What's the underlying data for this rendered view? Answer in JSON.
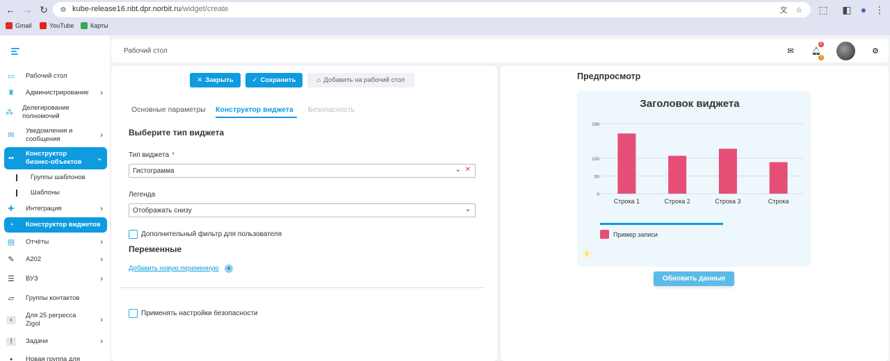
{
  "browser": {
    "url_host": "kube-release16.nbt.dpr.norbit.ru",
    "url_path": "/widget/create",
    "bookmarks": [
      {
        "label": "Gmail",
        "color": "#d93025"
      },
      {
        "label": "YouTube",
        "color": "#e62117"
      },
      {
        "label": "Карты",
        "color": "#34a853"
      }
    ]
  },
  "topbar": {
    "breadcrumb": "Рабочий стол",
    "notifications_count": "5",
    "tasks_count": "1"
  },
  "sidebar": {
    "items": [
      {
        "label": "Рабочий стол",
        "icon": "monitor-icon"
      },
      {
        "label": "Администрирование",
        "icon": "admin-icon"
      },
      {
        "label": "Делегирование полномочий",
        "icon": "delegation-icon"
      },
      {
        "label": "Уведомления и сообщения",
        "icon": "mail-icon"
      },
      {
        "label": "Конструктор бизнес-объектов",
        "icon": "constructor-icon"
      },
      {
        "label": "Группы шаблонов"
      },
      {
        "label": "Шаблоны"
      },
      {
        "label": "Интеграция",
        "icon": "puzzle-icon"
      },
      {
        "label": "Конструктор виджетов",
        "icon": "pie-icon"
      },
      {
        "label": "Отчёты",
        "icon": "report-icon"
      },
      {
        "label": "А202",
        "icon": "pencil-icon"
      },
      {
        "label": "ВУЗ",
        "icon": "list-icon"
      },
      {
        "label": "Группы контактов",
        "icon": "folder-icon"
      },
      {
        "label": "Для 25 регресса Zigol",
        "icon": "chevron-left-icon"
      },
      {
        "label": "Задачи",
        "icon": "exclamation-icon"
      },
      {
        "label": "Новая группа для"
      }
    ]
  },
  "actions": {
    "close": "Закрыть",
    "save": "Сохранить",
    "add_to_desktop": "Добавить на рабочий стол"
  },
  "tabs": [
    "Основные параметры",
    "Конструктор виджета",
    "Безопасность"
  ],
  "form": {
    "section_type": "Выберите тип виджета",
    "type_label": "Тип виджета",
    "required_mark": "*",
    "type_value": "Гистограмма",
    "legend_label": "Легенда",
    "legend_value": "Отображать снизу",
    "extra_filter": "Дополнительный фильтр для пользователя",
    "variables_title": "Переменные",
    "add_variable": "Добавить новую переменную",
    "security_settings": "Применять настройки безопасности"
  },
  "preview": {
    "title": "Предпросмотр",
    "refresh": "Обновить данные"
  },
  "chart_data": {
    "type": "bar",
    "title": "Заголовок виджета",
    "categories": [
      "Строка 1",
      "Строка 2",
      "Строка 3",
      "Строка"
    ],
    "series": [
      {
        "name": "Пример записи",
        "values": [
          170,
          107,
          127,
          89
        ],
        "color": "#e54f76"
      }
    ],
    "ylim": [
      0,
      198
    ],
    "yticks": [
      0,
      50,
      100,
      198
    ],
    "legend": "bottom",
    "grid": true
  }
}
